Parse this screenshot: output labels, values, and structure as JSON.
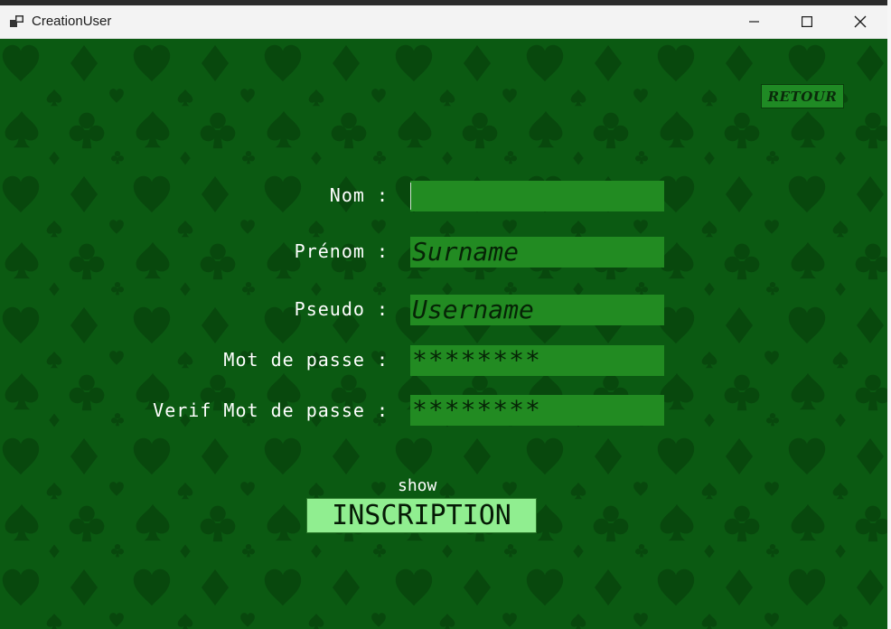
{
  "window": {
    "title": "CreationUser"
  },
  "buttons": {
    "retour": "RETOUR",
    "inscription": "INSCRIPTION",
    "show": "show"
  },
  "form": {
    "nom_label": "Nom :",
    "prenom_label": "Prénom :",
    "pseudo_label": "Pseudo :",
    "mdp_label": "Mot de passe :",
    "verif_label": "Verif Mot de passe :",
    "nom_value": "",
    "prenom_value": "Surname",
    "pseudo_value": "Username",
    "mdp_value": "********",
    "verif_value": "********"
  },
  "colors": {
    "background": "#0b5a12",
    "suit_pattern": "#08480d",
    "field": "#228b22",
    "inscription_button": "#90ee90",
    "retour_button": "#1f8a24"
  },
  "icons": {
    "app": "app-window-icon",
    "minimize": "minimize-icon",
    "maximize": "maximize-icon",
    "close": "close-icon",
    "background_pattern": "card-suits-pattern"
  }
}
